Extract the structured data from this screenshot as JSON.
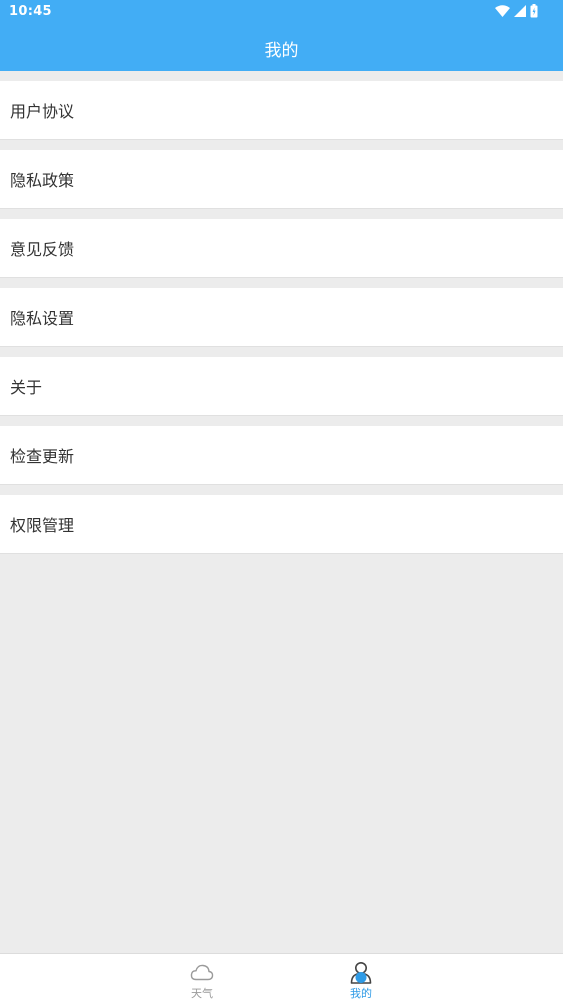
{
  "status": {
    "time": "10:45"
  },
  "header": {
    "title": "我的"
  },
  "menu": {
    "items": [
      {
        "label": "用户协议"
      },
      {
        "label": "隐私政策"
      },
      {
        "label": "意见反馈"
      },
      {
        "label": "隐私设置"
      },
      {
        "label": "关于"
      },
      {
        "label": "检查更新"
      },
      {
        "label": "权限管理"
      }
    ]
  },
  "tabbar": {
    "tabs": [
      {
        "label": "天气",
        "icon": "cloud-icon",
        "active": false
      },
      {
        "label": "我的",
        "icon": "user-icon",
        "active": true
      }
    ]
  },
  "colors": {
    "header": "#42adf5",
    "page_background": "#ececec",
    "active_tab": "#2f9be6",
    "inactive_tab": "#9a9a9a"
  }
}
